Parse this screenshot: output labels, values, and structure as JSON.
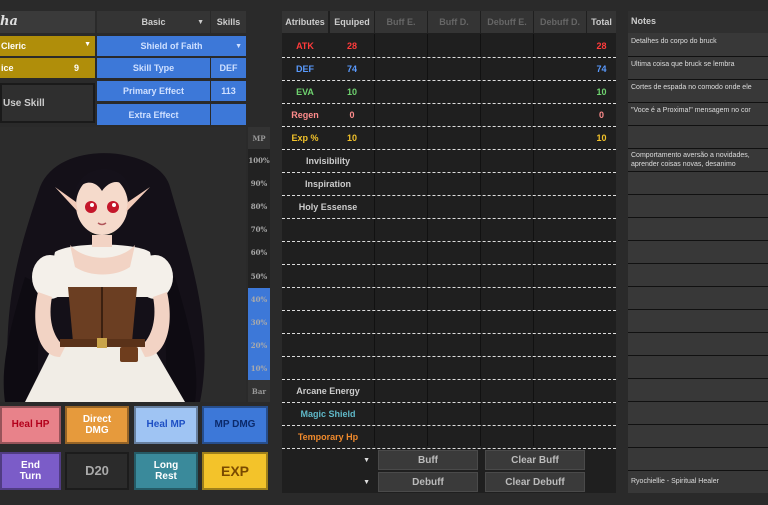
{
  "left_panel": {
    "title_partial": "ha",
    "class_label": "Cleric",
    "slot_label": "ice",
    "slot_value": "9",
    "use_skill_label": "Use Skill"
  },
  "skills_panel": {
    "tab_basic": "Basic",
    "tab_skills": "Skills",
    "skill_name": "Shield of Faith",
    "skill_type_label": "Skill Type",
    "skill_type_value": "DEF",
    "primary_effect_label": "Primary Effect",
    "primary_effect_value": "113",
    "extra_effect_label": "Extra Effect"
  },
  "mp_bar": {
    "title": "MP",
    "footer": "Bar",
    "ticks": [
      "100%",
      "90%",
      "80%",
      "70%",
      "60%",
      "50%",
      "40%",
      "30%",
      "20%",
      "10%"
    ],
    "fill_fraction": 0.4,
    "fill_color": "#3d78d8"
  },
  "action_buttons": [
    {
      "label": "Heal HP",
      "bg": "#e8828a",
      "color": "#b3001b"
    },
    {
      "label": "Direct DMG",
      "bg": "#e69a3c",
      "color": "#ffffff"
    },
    {
      "label": "Heal MP",
      "bg": "#9fc4f3",
      "color": "#1d4fc4"
    },
    {
      "label": "MP DMG",
      "bg": "#3d78d8",
      "color": "#0b2a6b"
    },
    {
      "label": "End Turn",
      "bg": "#7b5cc8",
      "color": "#ffffff"
    },
    {
      "label": "D20",
      "bg": "#2b2b2b",
      "color": "#aaaaaa"
    },
    {
      "label": "Long Rest",
      "bg": "#3a8a9b",
      "color": "#ffffff"
    },
    {
      "label": "EXP",
      "bg": "#f3c32a",
      "color": "#7a4a00"
    }
  ],
  "stats_table": {
    "headers": [
      "Atributes",
      "Equiped",
      "Buff E.",
      "Buff D.",
      "Debuff E.",
      "Debuff D.",
      "Total"
    ],
    "rows": [
      {
        "name": "ATK",
        "equiped": "28",
        "total": "28",
        "color": "#ff3b3b"
      },
      {
        "name": "DEF",
        "equiped": "74",
        "total": "74",
        "color": "#5a9bff"
      },
      {
        "name": "EVA",
        "equiped": "10",
        "total": "10",
        "color": "#6fd36f"
      },
      {
        "name": "Regen",
        "equiped": "0",
        "total": "0",
        "color": "#ff8c8c"
      },
      {
        "name": "Exp %",
        "equiped": "10",
        "total": "10",
        "color": "#f3c32a"
      }
    ],
    "extra_rows": [
      "Invisibility",
      "Inspiration",
      "Holy Essense"
    ],
    "bottom_rows": [
      {
        "name": "Arcane Energy",
        "color": "#cccccc"
      },
      {
        "name": "Magic Shield",
        "color": "#5fb8c8"
      },
      {
        "name": "Temporary Hp",
        "color": "#f08a2c"
      }
    ],
    "buff_button": "Buff",
    "clear_buff_button": "Clear Buff",
    "debuff_button": "Debuff",
    "clear_debuff_button": "Clear Debuff"
  },
  "notes": {
    "title": "Notes",
    "items": [
      "Detalhes do corpo do bruck",
      "Ultima coisa que bruck se lembra",
      "Cortes de espada no comodo onde ele",
      "\"Voce é a Proxima!\" mensagem no cor",
      "Comportamento aversão a novidades,",
      "aprender coisas novas, desanimo"
    ],
    "footer": "Ryochiellie - Spiritual Healer"
  }
}
